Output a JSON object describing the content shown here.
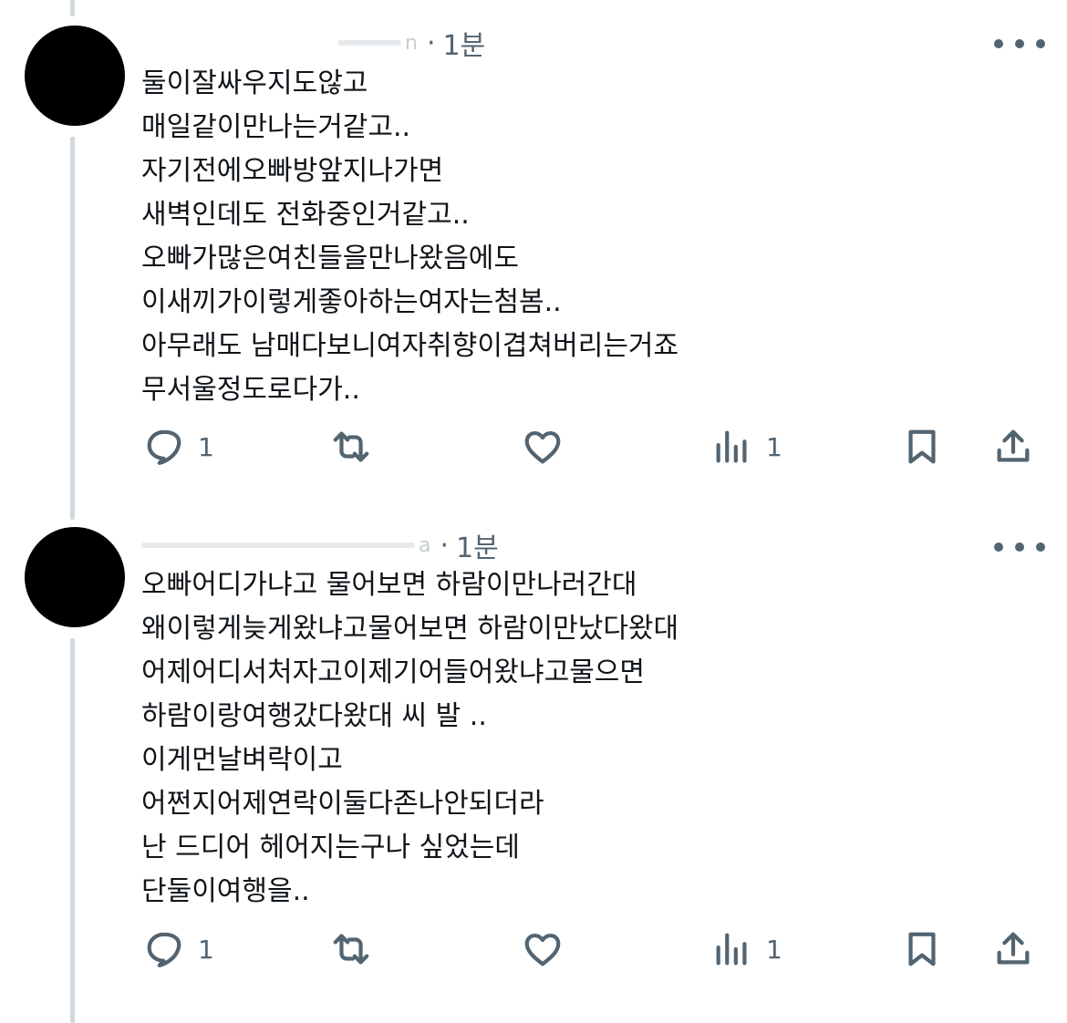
{
  "tweets": [
    {
      "time": "1분",
      "handle_tail": "n",
      "lines": [
        "둘이잘싸우지도않고",
        "매일같이만나는거같고..",
        "자기전에오빠방앞지나가면",
        "새벽인데도 전화중인거같고..",
        "오빠가많은여친들을만나왔음에도",
        "이새끼가이렇게좋아하는여자는첨봄..",
        "아무래도 남매다보니여자취향이겹쳐버리는거죠",
        "무서울정도로다가.."
      ],
      "reply_count": "1",
      "views_count": "1"
    },
    {
      "time": "1분",
      "handle_tail": "a",
      "lines": [
        "오빠어디가냐고 물어보면 하람이만나러간대",
        "왜이렇게늦게왔냐고물어보면 하람이만났다왔대",
        "어제어디서처자고이제기어들어왔냐고물으면",
        "하람이랑여행갔다왔대 씨 발 ..",
        "이게먼날벼락이고",
        "어쩐지어제연락이둘다존나안되더라",
        "난 드디어 헤어지는구나 싶었는데",
        "단둘이여행을.."
      ],
      "reply_count": "1",
      "views_count": "1"
    }
  ],
  "icons": {
    "reply": "reply-icon",
    "retweet": "retweet-icon",
    "like": "heart-icon",
    "views": "views-icon",
    "bookmark": "bookmark-icon",
    "share": "share-icon",
    "more": "more-icon"
  },
  "colors": {
    "text": "#0f1419",
    "secondary": "#536471",
    "thread_line": "#cfd9de"
  }
}
